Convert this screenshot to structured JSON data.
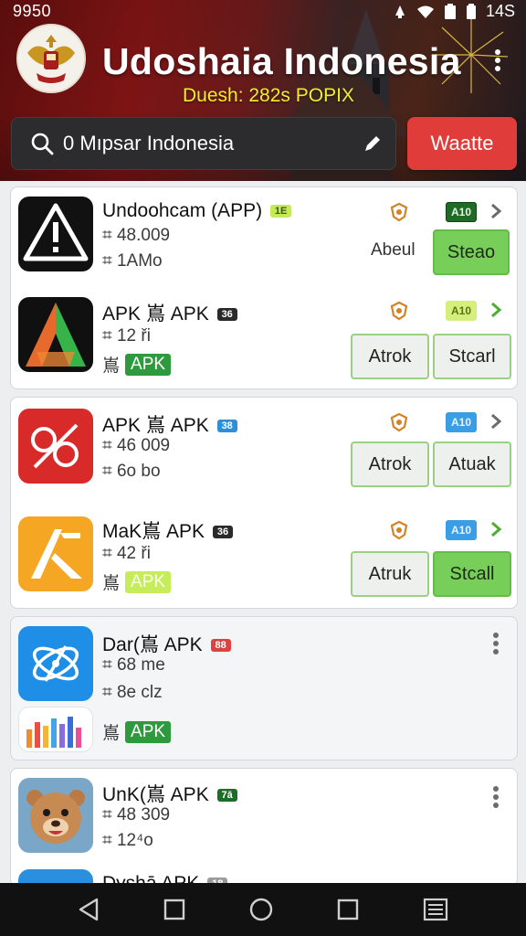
{
  "status_bar": {
    "time": "9950",
    "right_text": "14S"
  },
  "header": {
    "title": "Udoshaia Indonesia",
    "subtitle": "Duesh: 282s POPIX",
    "search": {
      "text": "0 Mıpsar Indonesia"
    },
    "action_label": "Waatte",
    "accent_color": "#e03c3a"
  },
  "cards": [
    {
      "rows": [
        {
          "icon": "warning-icon",
          "name": "Undoohcam (APP)",
          "tag": "1E",
          "meta1": "⌗ 48.009",
          "meta2": "⌗ 1AMo",
          "version": "A10",
          "text_label": "Abeul",
          "button": "Steao"
        },
        {
          "icon": "a-logo-icon",
          "name": "APK 嶌 APK",
          "tag": "36",
          "meta1": "⌗ 12 ři",
          "flag_prefix": "嶌",
          "badge": "APK",
          "version": "A10",
          "button_left": "Atrok",
          "button_right": "Stcarl"
        }
      ]
    },
    {
      "rows": [
        {
          "icon": "link-icon",
          "name": "APK 嶌 APK",
          "tag": "38",
          "meta1": "⌗ 46 009",
          "meta2": "⌗ 6o bo",
          "version": "A10",
          "button_left": "Atrok",
          "button_right": "Atuak"
        },
        {
          "icon": "x-logo-icon",
          "name": "MaK嶌 APK",
          "tag": "36",
          "meta1": "⌗ 42 ři",
          "flag_prefix": "嶌",
          "badge": "APK",
          "version": "A10",
          "button_left": "Atruk",
          "button_right": "Stcall"
        }
      ]
    },
    {
      "rows": [
        {
          "icon": "atom-icon",
          "name": "Dar(嶌 APK",
          "tag": "88",
          "meta1": "⌗ 68 me",
          "meta2": "⌗ 8e clz"
        },
        {
          "icon": "bar-chart-icon",
          "flag_prefix": "嶌",
          "badge": "APK"
        }
      ]
    },
    {
      "rows": [
        {
          "icon": "bear-icon",
          "name": "UnK(嶌 APK",
          "tag": "7ā",
          "meta1": "⌗ 48 309",
          "meta2": "⌗ 12⁴o"
        },
        {
          "icon": "partial-icon",
          "name": "Dyshā APK",
          "tag": "18"
        }
      ]
    }
  ],
  "nav": {
    "icons": [
      "back-icon",
      "home-square-icon",
      "home-circle-icon",
      "recents-icon",
      "menu-icon"
    ]
  }
}
